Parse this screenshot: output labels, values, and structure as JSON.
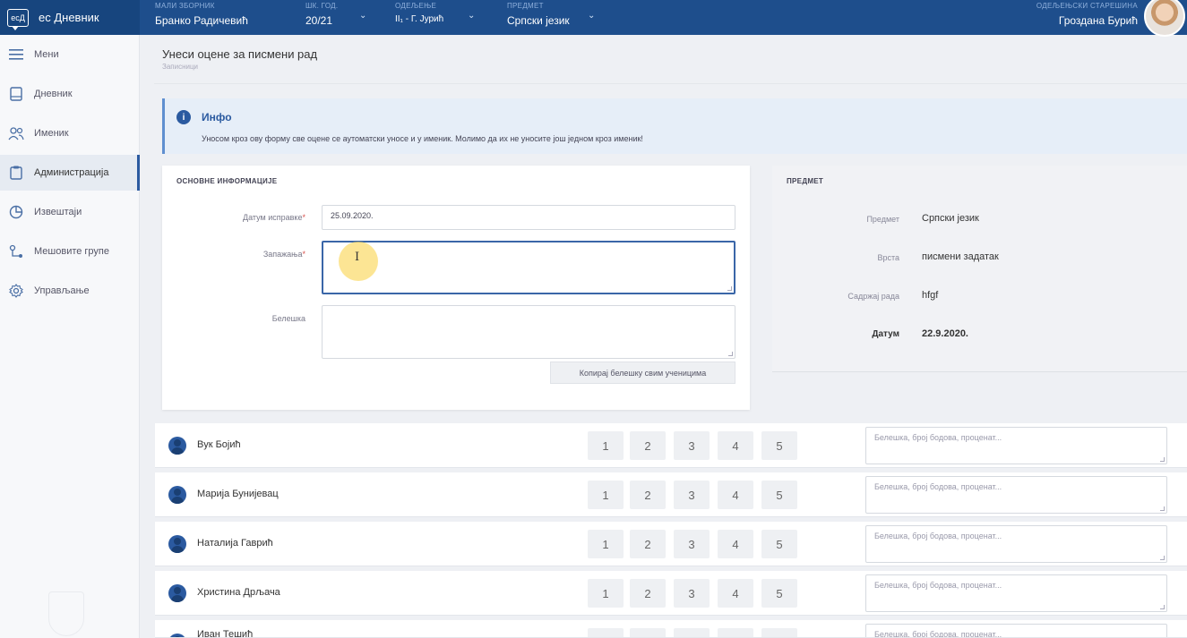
{
  "app": {
    "logo_mark": "ecД",
    "name": "ес Дневник"
  },
  "topbar": {
    "journal": {
      "label": "мали зборник",
      "value": "Бранко Радичевић"
    },
    "year": {
      "label": "шк. год.",
      "value": "20/21"
    },
    "class": {
      "label": "одељење",
      "value": "II₁ - Г. Јурић"
    },
    "subject": {
      "label": "предмет",
      "value": "Српски језик"
    },
    "user": {
      "role": "одељењски старешина",
      "name": "Гроздана Бурић"
    }
  },
  "sidebar": {
    "items": [
      {
        "label": "Мени",
        "icon": "menu-icon"
      },
      {
        "label": "Дневник",
        "icon": "book-icon"
      },
      {
        "label": "Именик",
        "icon": "users-icon"
      },
      {
        "label": "Администрација",
        "icon": "clipboard-icon"
      },
      {
        "label": "Извештаји",
        "icon": "pie-chart-icon"
      },
      {
        "label": "Мешовите групе",
        "icon": "group-icon"
      },
      {
        "label": "Управљање",
        "icon": "gear-icon"
      }
    ],
    "active_index": 3
  },
  "page": {
    "title": "Унеси оцене за писмени рад",
    "breadcrumb": "Записници"
  },
  "info": {
    "title": "Инфо",
    "text": "Уносом кроз ову форму све оцене се аутоматски уносе и у именик. Молимо да их не уносите још једном кроз именик!"
  },
  "basic_info": {
    "heading": "Основне информације",
    "date_label": "Датум исправке",
    "date_value": "25.09.2020.",
    "observations_label": "Запажања",
    "observations_value": "",
    "note_label": "Белешка",
    "note_value": "",
    "copy_button": "Копирај белешку свим ученицима"
  },
  "subject_info": {
    "heading": "Предмет",
    "rows": [
      {
        "key": "Предмет",
        "value": "Српски језик"
      },
      {
        "key": "Врста",
        "value": "писмени задатак"
      },
      {
        "key": "Садржај рада",
        "value": "hfgf"
      },
      {
        "key": "Датум",
        "value": "22.9.2020."
      }
    ]
  },
  "grades": [
    "1",
    "2",
    "3",
    "4",
    "5"
  ],
  "note_placeholder": "Белешка, број бодова, проценат...",
  "students": [
    {
      "name": "Вук Бојић"
    },
    {
      "name": "Марија Бунијевац"
    },
    {
      "name": "Наталија Гаврић"
    },
    {
      "name": "Христина Дрљача"
    },
    {
      "name": "Иван Тешић"
    }
  ],
  "colors": {
    "topbar": "#1e4e8c",
    "accent": "#2b5aa0",
    "info_bg": "#e6eef8"
  }
}
